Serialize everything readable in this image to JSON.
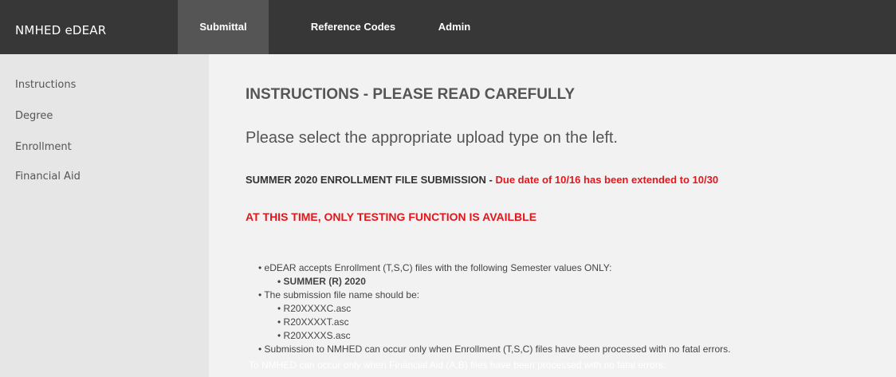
{
  "header": {
    "brand": "NMHED eDEAR",
    "tabs": [
      {
        "label": "Submittal",
        "active": true
      },
      {
        "label": "Reference Codes",
        "active": false
      },
      {
        "label": "Admin",
        "active": false
      }
    ]
  },
  "sidebar": {
    "items": [
      {
        "label": "Instructions"
      },
      {
        "label": "Degree"
      },
      {
        "label": "Enrollment"
      },
      {
        "label": "Financial Aid"
      }
    ]
  },
  "main": {
    "heading": "INSTRUCTIONS - PLEASE READ CAREFULLY",
    "subheading": "Please select the appropriate upload type on the left.",
    "notice_prefix": "SUMMER 2020 ENROLLMENT FILE SUBMISSION",
    "notice_separator": " - ",
    "notice_due": "Due date of 10/16 has been extended to 10/30",
    "alert": "AT THIS TIME, ONLY TESTING FUNCTION IS AVAILBLE",
    "list": {
      "item1": "• eDEAR accepts Enrollment (T,S,C) files with the following Semester values ONLY:",
      "item1_sub": "• SUMMER (R) 2020",
      "item2": "• The submission file name should be:",
      "item2_subs": [
        "• R20XXXXC.asc",
        "• R20XXXXT.asc",
        "• R20XXXXS.asc"
      ],
      "item3": "• Submission to NMHED can occur only when Enrollment (T,S,C) files have been processed with no fatal errors."
    },
    "faded_line": "To NMHED can occur only when Financial Aid (A,B) files have been processed with no fatal errors."
  },
  "colors": {
    "topbar": "#373737",
    "active_tab": "#555555",
    "sidebar": "#e6e6e6",
    "main_bg": "#f2f2f2",
    "alert_red": "#e4161b",
    "text_gray": "#555555"
  }
}
